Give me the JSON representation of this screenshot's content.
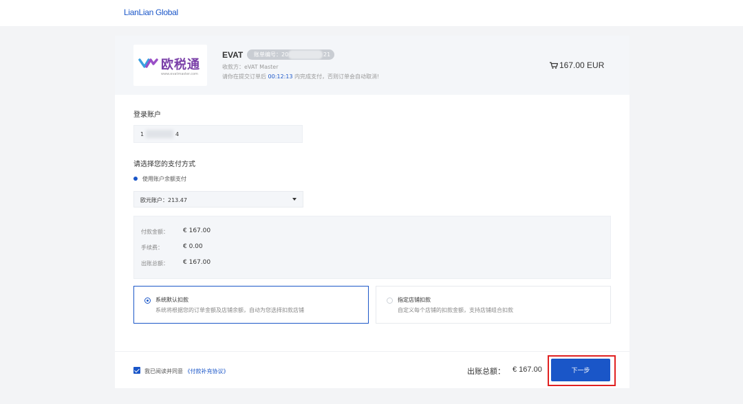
{
  "brand": "LianLian Global",
  "merchant": {
    "logo_text": "欧税通",
    "logo_url_text": "www.evatmaster.com",
    "title": "EVAT",
    "order_label": "账单编号：20",
    "order_suffix": "21",
    "payee": "收款方：eVAT Master",
    "notice_prefix": "请你在提交订单后 ",
    "countdown": "00:12:13",
    "notice_suffix": " 内完成支付，否则订单会自动取消!",
    "amount": "167.00 EUR"
  },
  "login": {
    "label": "登录账户",
    "account_prefix": "1",
    "account_suffix": "4"
  },
  "payment": {
    "label": "请选择您的支付方式",
    "method": "使用账户余额支付",
    "account_select": "欧元账户：213.47"
  },
  "summary": {
    "rows": [
      {
        "label": "付款金额：",
        "value": "€ 167.00"
      },
      {
        "label": "手续费：",
        "value": "€ 0.00"
      },
      {
        "label": "出账总额：",
        "value": "€ 167.00"
      }
    ]
  },
  "deduction_options": [
    {
      "title": "系统默认扣款",
      "desc": "系统将根据您的订单金额及店铺余额，自动为您选择扣款店铺",
      "selected": true
    },
    {
      "title": "指定店铺扣款",
      "desc": "自定义每个店铺的扣款金额，支持店铺组合扣款",
      "selected": false
    }
  ],
  "footer": {
    "agree_text": "我已阅读并同意",
    "agreement_link": "《付款补充协议》",
    "total_label": "出账总额：",
    "total_value": "€ 167.00",
    "next_label": "下一步"
  },
  "colors": {
    "accent": "#1a56c8",
    "highlight_border": "#e02020",
    "logo_purple": "#7a3fa8"
  }
}
